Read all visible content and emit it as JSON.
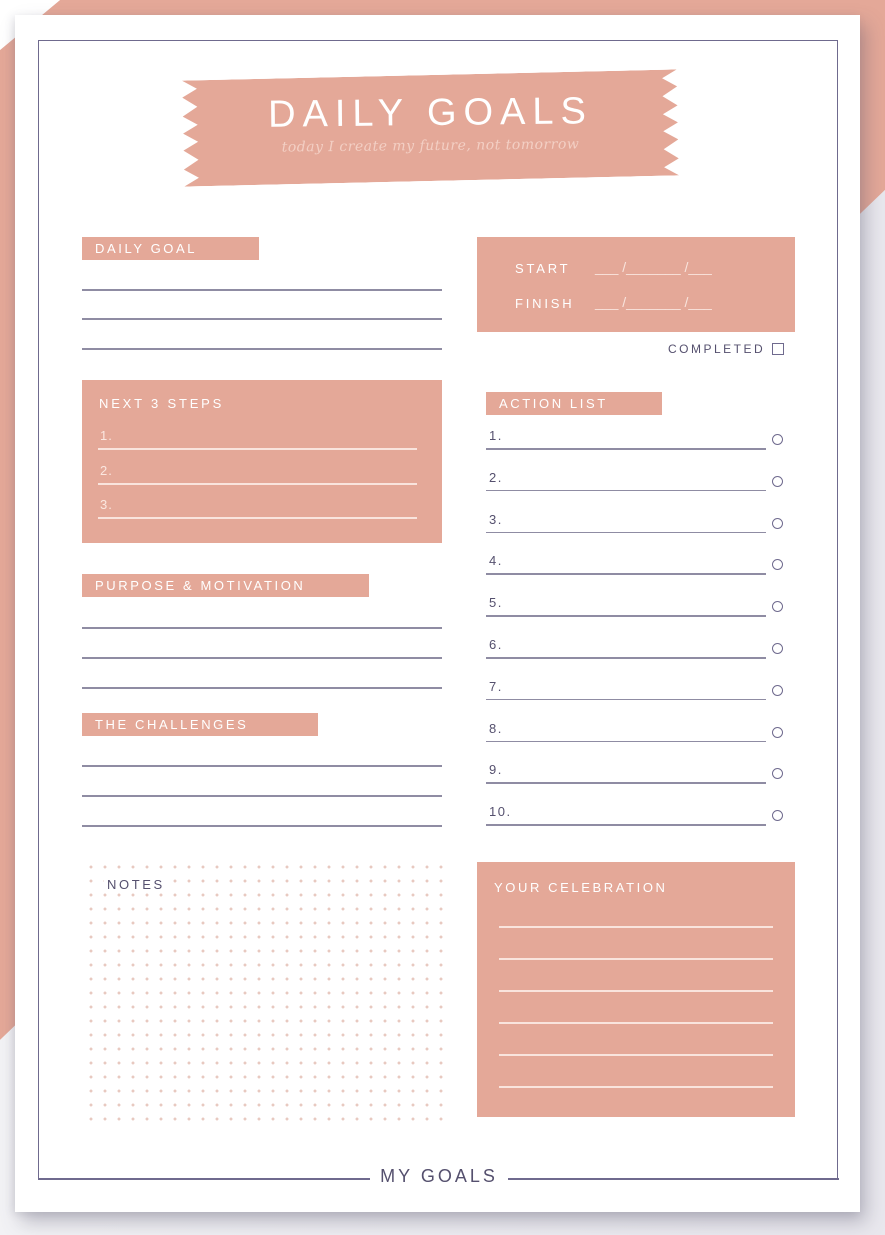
{
  "colors": {
    "accent": "#e4a898",
    "ink": "#55506e",
    "frame": "#6f6a8e"
  },
  "header": {
    "title": "DAILY GOALS",
    "subtitle": "today I create my future, not tomorrow"
  },
  "daily_goal": {
    "label": "DAILY GOAL",
    "lines": 3
  },
  "dates": {
    "start_label": "START",
    "finish_label": "FINISH",
    "blank": "___ /_______ /___",
    "completed_label": "COMPLETED",
    "completed_checked": false
  },
  "next_steps": {
    "label": "NEXT 3 STEPS",
    "items": [
      "1.",
      "2.",
      "3."
    ]
  },
  "action_list": {
    "label": "ACTION LIST",
    "items": [
      "1.",
      "2.",
      "3.",
      "4.",
      "5.",
      "6.",
      "7.",
      "8.",
      "9.",
      "10."
    ]
  },
  "purpose": {
    "label": "PURPOSE & MOTIVATION",
    "lines": 3
  },
  "challenges": {
    "label": "THE CHALLENGES",
    "lines": 3
  },
  "notes": {
    "label": "NOTES"
  },
  "celebration": {
    "label": "YOUR CELEBRATION",
    "lines": 6
  },
  "footer": {
    "title": "MY GOALS"
  }
}
